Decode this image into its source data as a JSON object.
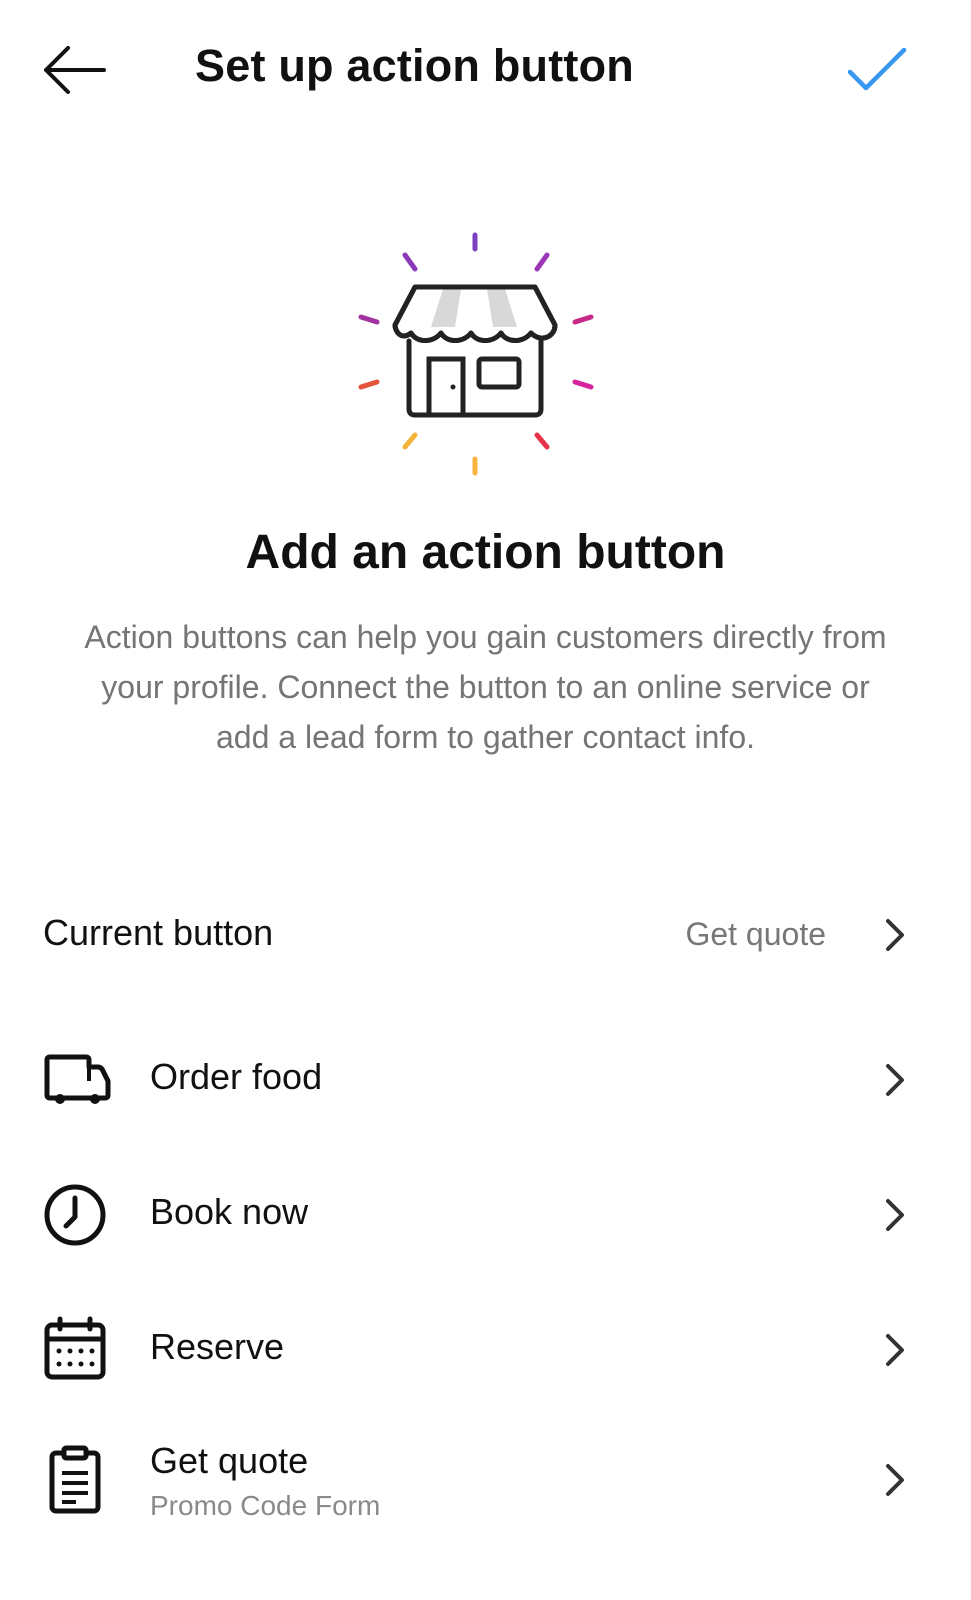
{
  "header": {
    "title": "Set up action button",
    "back_icon": "arrow-left-icon",
    "done_icon": "checkmark-icon",
    "accent_color": "#3897f0"
  },
  "hero": {
    "icon": "storefront-icon",
    "title": "Add an action button",
    "description": "Action buttons can help you gain customers directly from your profile. Connect the button to an online service or add a lead form to gather contact info."
  },
  "current_button": {
    "label": "Current button",
    "value": "Get quote"
  },
  "options": [
    {
      "icon": "delivery-truck-icon",
      "label": "Order food"
    },
    {
      "icon": "clock-icon",
      "label": "Book now"
    },
    {
      "icon": "calendar-icon",
      "label": "Reserve"
    },
    {
      "icon": "clipboard-form-icon",
      "label": "Get quote",
      "sublabel": "Promo Code Form"
    }
  ]
}
